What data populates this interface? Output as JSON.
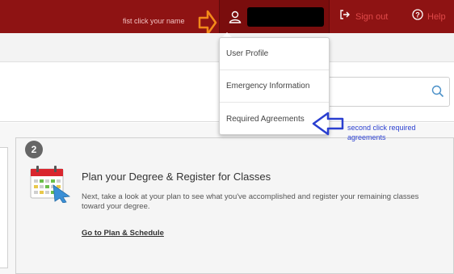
{
  "header": {
    "hint_text": "fist click your name",
    "signout_label": "Sign out",
    "help_label": "Help"
  },
  "user_menu": {
    "items": [
      {
        "label": "User Profile"
      },
      {
        "label": "Emergency Information"
      },
      {
        "label": "Required Agreements"
      }
    ]
  },
  "annotations": {
    "second_hint": "second click required agreements"
  },
  "search": {
    "placeholder": ""
  },
  "card": {
    "step_number": "2",
    "title": "Plan your Degree & Register for Classes",
    "description": "Next, take a look at your plan to see what you've accomplished and register your remaining classes toward your degree.",
    "link_label": "Go to Plan & Schedule"
  },
  "colors": {
    "header_bg": "#8e1313",
    "accent_orange": "#f28a1a",
    "annotation_blue": "#2a3fd0",
    "link_red": "#e04a4a"
  },
  "icons": [
    "user-icon",
    "sign-out-icon",
    "help-icon",
    "search-icon",
    "calendar-icon",
    "arrow-right-icon",
    "arrow-left-icon"
  ]
}
